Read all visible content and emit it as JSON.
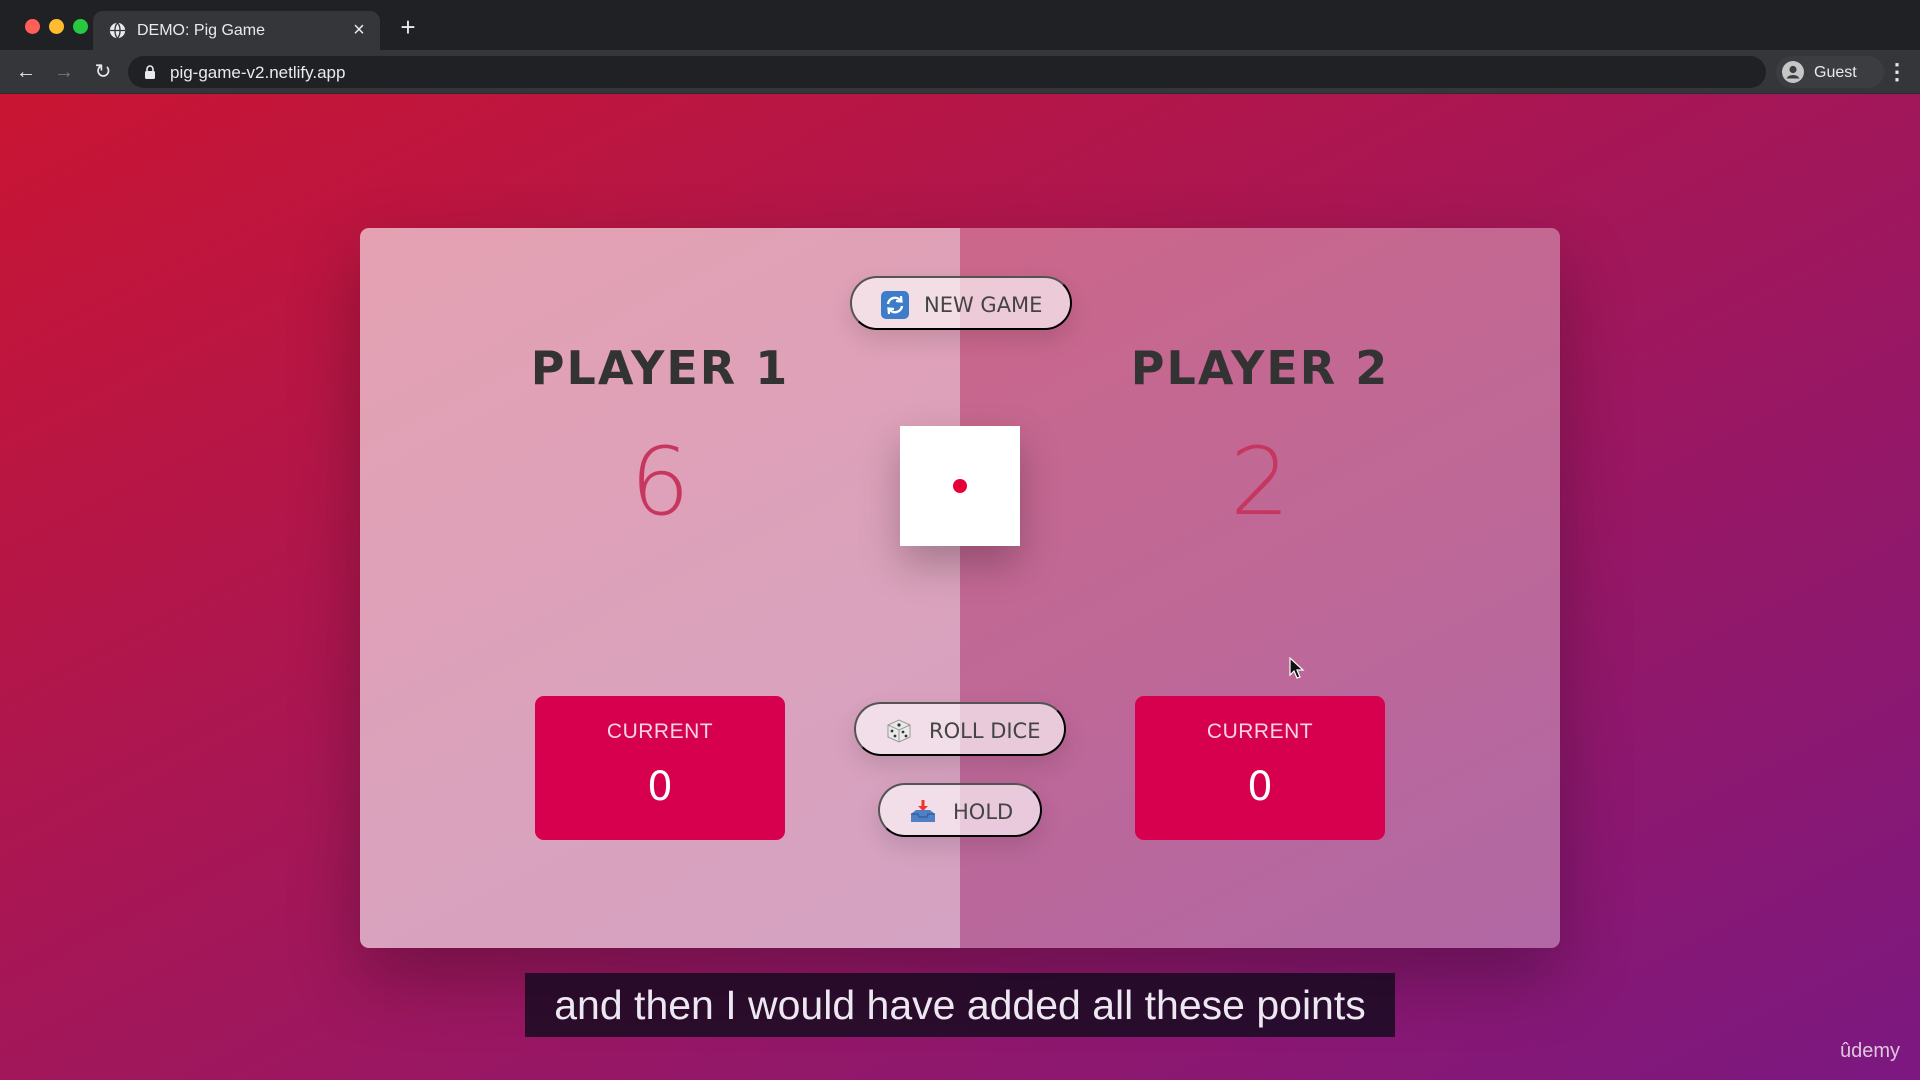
{
  "browser": {
    "tab": {
      "title": "DEMO: Pig Game",
      "close_glyph": "×",
      "favicon": "globe-icon"
    },
    "new_tab_glyph": "+",
    "nav": {
      "back_glyph": "←",
      "forward_glyph": "→",
      "reload_glyph": "↻"
    },
    "url": "pig-game-v2.netlify.app",
    "profile_name": "Guest",
    "menu_glyph": "⋮"
  },
  "game": {
    "new_game_label": "NEW GAME",
    "roll_dice_label": "ROLL DICE",
    "hold_label": "HOLD",
    "dice_value": 1,
    "players": [
      {
        "name": "PLAYER 1",
        "score": "6",
        "current_label": "CURRENT",
        "current_score": "0"
      },
      {
        "name": "PLAYER 2",
        "score": "2",
        "current_label": "CURRENT",
        "current_score": "0"
      }
    ]
  },
  "overlay": {
    "subtitle": "and then I would have added all these points",
    "watermark": "ûdemy"
  },
  "colors": {
    "score_pink": "#c7365f",
    "current_box": "#d6004f",
    "dice_pip": "#e8003c"
  }
}
